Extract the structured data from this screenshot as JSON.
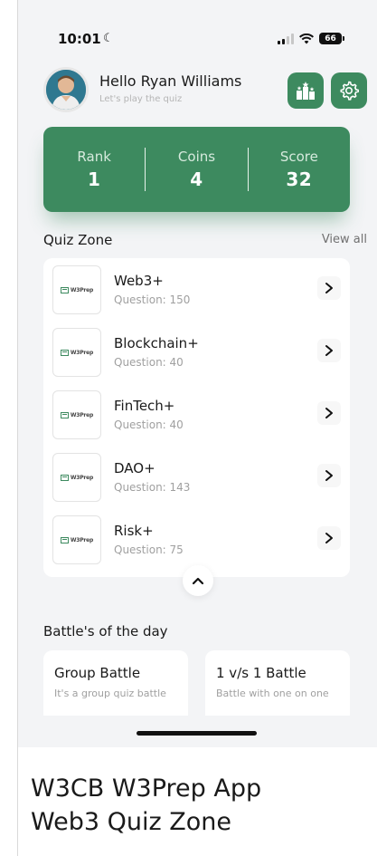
{
  "status_bar": {
    "time": "10:01",
    "battery": "66"
  },
  "header": {
    "greeting": "Hello Ryan Williams",
    "subtitle": "Let's play the quiz"
  },
  "stats": [
    {
      "label": "Rank",
      "value": "1"
    },
    {
      "label": "Coins",
      "value": "4"
    },
    {
      "label": "Score",
      "value": "32"
    }
  ],
  "quiz_zone": {
    "title": "Quiz Zone",
    "view_all": "View all",
    "logo_text": "W3Prep",
    "items": [
      {
        "name": "Web3+",
        "questions": "Question: 150"
      },
      {
        "name": "Blockchain+",
        "questions": "Question: 40"
      },
      {
        "name": "FinTech+",
        "questions": "Question: 40"
      },
      {
        "name": "DAO+",
        "questions": "Question: 143"
      },
      {
        "name": "Risk+",
        "questions": "Question: 75"
      }
    ]
  },
  "battles": {
    "title": "Battle's of the day",
    "items": [
      {
        "title": "Group Battle",
        "desc": "It's a group quiz battle"
      },
      {
        "title": "1 v/s 1 Battle",
        "desc": "Battle with one on one"
      }
    ]
  },
  "caption": {
    "line1": "W3CB W3Prep App",
    "line2": "Web3 Quiz Zone"
  },
  "colors": {
    "accent": "#3d8a5f",
    "background": "#f3f4f6"
  }
}
